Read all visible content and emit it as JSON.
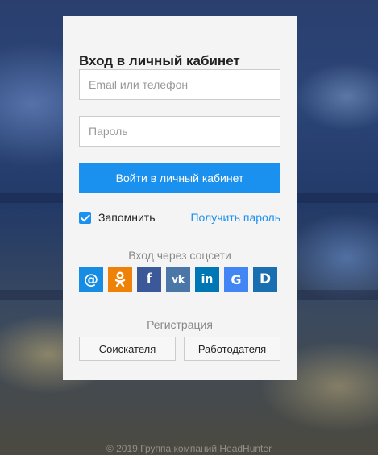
{
  "login": {
    "title": "Вход в личный кабинет",
    "email_placeholder": "Email или телефон",
    "password_placeholder": "Пароль",
    "submit_label": "Войти в личный кабинет",
    "remember_label": "Запомнить",
    "remember_checked": true,
    "forgot_label": "Получить пароль"
  },
  "social": {
    "caption": "Вход через соцсети",
    "providers": [
      {
        "name": "mail",
        "glyph": "@",
        "color": "#168de2"
      },
      {
        "name": "odnoklassniki",
        "glyph": "ok",
        "color": "#ee8208"
      },
      {
        "name": "facebook",
        "glyph": "f",
        "color": "#3b5998"
      },
      {
        "name": "vkontakte",
        "glyph": "vk",
        "color": "#4a76a8"
      },
      {
        "name": "linkedin",
        "glyph": "in",
        "color": "#0077b5"
      },
      {
        "name": "google",
        "glyph": "G",
        "color": "#4285f4"
      },
      {
        "name": "headhunter",
        "glyph": "D",
        "color": "#1a6fb0"
      }
    ]
  },
  "registration": {
    "caption": "Регистрация",
    "seeker_label": "Соискателя",
    "employer_label": "Работодателя"
  },
  "footer": {
    "text": "© 2019 Группа компаний HeadHunter"
  },
  "colors": {
    "accent": "#1a90ef",
    "card_bg": "#f4f4f5"
  }
}
